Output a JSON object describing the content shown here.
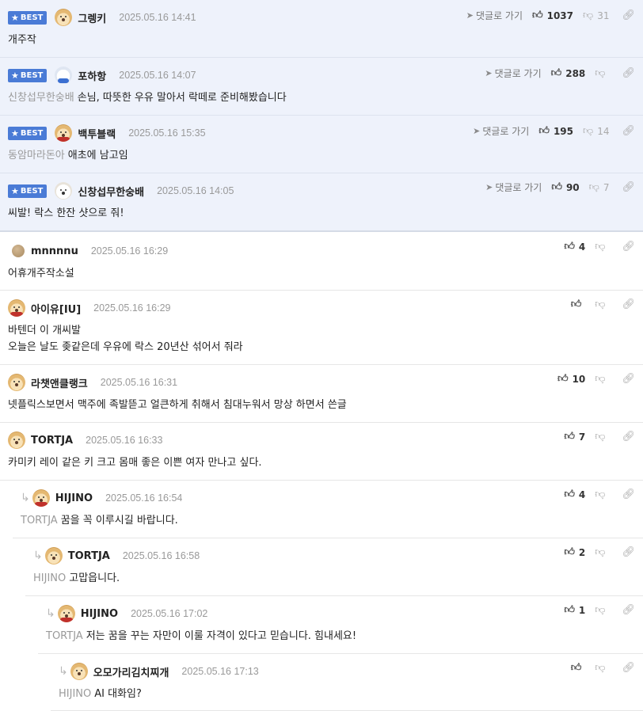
{
  "best_badge": "BEST",
  "goto_label": "댓글로 가기",
  "best_comments": [
    {
      "nick": "그렝키",
      "date": "2025.05.16 14:41",
      "mention": "",
      "text": "개주작",
      "likes": "1037",
      "dislikes": "31",
      "avatar": "dog-icon"
    },
    {
      "nick": "포하항",
      "date": "2025.05.16 14:07",
      "mention": "신창섭무한숭배",
      "text": "손님, 따뜻한 우유 말아서 락떼로 준비해봤습니다",
      "likes": "288",
      "dislikes": "",
      "avatar": "bear-icon"
    },
    {
      "nick": "백투블랙",
      "date": "2025.05.16 15:35",
      "mention": "동암마라돈아",
      "text": "애초에 남고임",
      "likes": "195",
      "dislikes": "14",
      "avatar": "dog-red-icon"
    },
    {
      "nick": "신창섭무한숭배",
      "date": "2025.05.16 14:05",
      "mention": "",
      "text": "씨발! 락스 한잔 샷으로 줘!",
      "likes": "90",
      "dislikes": "7",
      "avatar": "white-dog-icon"
    }
  ],
  "comments": [
    {
      "nick": "mnnnnu",
      "date": "2025.05.16 16:29",
      "mention": "",
      "lines": [
        "어휴개주작소설"
      ],
      "likes": "4",
      "dislikes": "",
      "avatar": "ball-icon"
    },
    {
      "nick": "아이유[IU]",
      "date": "2025.05.16 16:29",
      "mention": "",
      "lines": [
        "바텐더 이 개씨발",
        "오늘은 날도 좆같은데 우유에 락스 20년산 섞어서 줘라"
      ],
      "likes": "",
      "dislikes": "",
      "avatar": "dog-red-icon"
    },
    {
      "nick": "라챗앤클랭크",
      "date": "2025.05.16 16:31",
      "mention": "",
      "lines": [
        "넷플릭스보면서 맥주에 족발뜯고 얼큰하게 취해서 침대누워서 망상 하면서 쓴글"
      ],
      "likes": "10",
      "dislikes": "",
      "avatar": "dog-icon"
    },
    {
      "nick": "TORTJA",
      "date": "2025.05.16 16:33",
      "mention": "",
      "lines": [
        "카미키 레이 같은 키 크고 몸매 좋은 이쁜 여자 만나고 싶다."
      ],
      "likes": "7",
      "dislikes": "",
      "avatar": "dog-icon"
    },
    {
      "nick": "HIJINO",
      "date": "2025.05.16 16:54",
      "mention": "TORTJA",
      "lines": [
        "꿈을 꼭 이루시길 바랍니다."
      ],
      "likes": "4",
      "dislikes": "",
      "avatar": "dog-red-icon"
    },
    {
      "nick": "TORTJA",
      "date": "2025.05.16 16:58",
      "mention": "HIJINO",
      "lines": [
        "고맙읍니다."
      ],
      "likes": "2",
      "dislikes": "",
      "avatar": "dog-icon"
    },
    {
      "nick": "HIJINO",
      "date": "2025.05.16 17:02",
      "mention": "TORTJA",
      "lines": [
        "저는 꿈을 꾸는 자만이 이룰 자격이 있다고 믿습니다. 힘내세요!"
      ],
      "likes": "1",
      "dislikes": "",
      "avatar": "dog-red-icon"
    },
    {
      "nick": "오모가리김치찌개",
      "date": "2025.05.16 17:13",
      "mention": "HIJINO",
      "lines": [
        "AI 대화임?"
      ],
      "likes": "",
      "dislikes": "",
      "avatar": "dog-icon"
    }
  ]
}
